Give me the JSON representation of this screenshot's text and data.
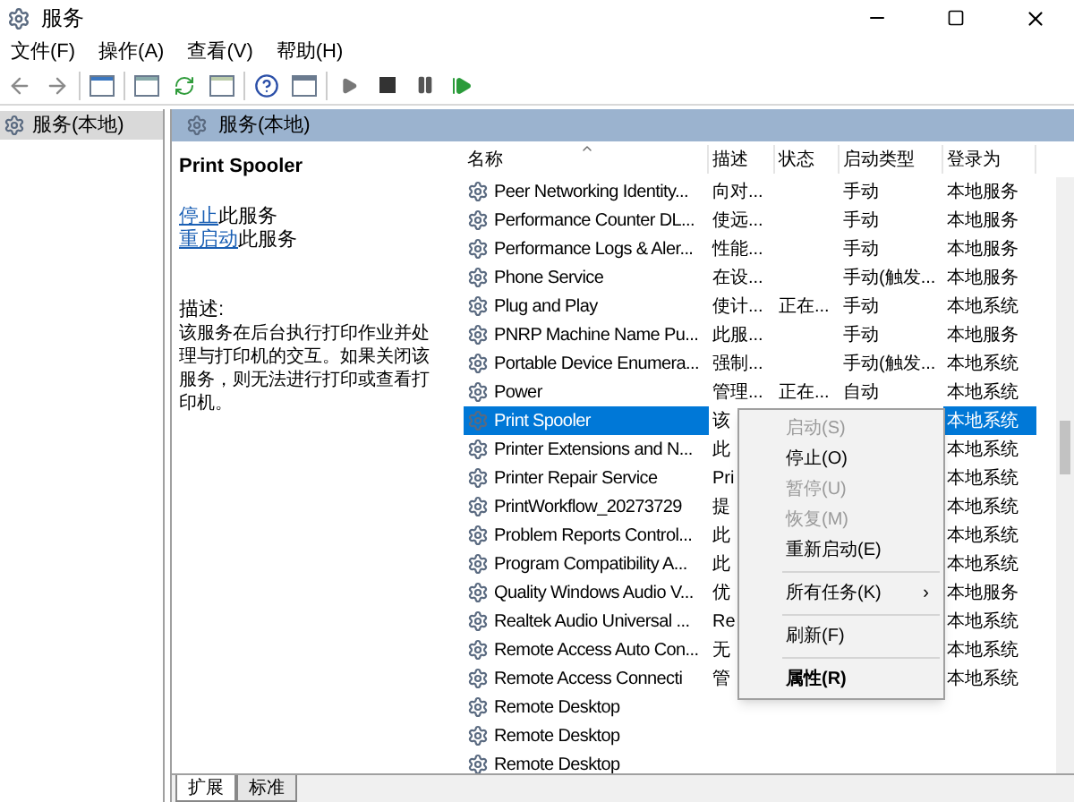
{
  "window": {
    "title": "服务"
  },
  "menu": [
    "文件(F)",
    "操作(A)",
    "查看(V)",
    "帮助(H)"
  ],
  "tree": {
    "items": [
      {
        "label": "服务(本地)",
        "selected": true
      }
    ]
  },
  "panel": {
    "title": "服务(本地)"
  },
  "detail": {
    "service_name": "Print Spooler",
    "actions": [
      {
        "link": "停止",
        "rest": "此服务"
      },
      {
        "link": "重启动",
        "rest": "此服务"
      }
    ],
    "description_label": "描述:",
    "description": "该服务在后台执行打印作业并处理与打印机的交互。如果关闭该服务，则无法进行打印或查看打印机。"
  },
  "table": {
    "columns": [
      "名称",
      "描述",
      "状态",
      "启动类型",
      "登录为"
    ],
    "rows": [
      {
        "name": "Peer Networking Identity...",
        "description": "向对...",
        "status": "",
        "startup": "手动",
        "logon": "本地服务",
        "selected": false
      },
      {
        "name": "Performance Counter DL...",
        "description": "使远...",
        "status": "",
        "startup": "手动",
        "logon": "本地服务",
        "selected": false
      },
      {
        "name": "Performance Logs & Aler...",
        "description": "性能...",
        "status": "",
        "startup": "手动",
        "logon": "本地服务",
        "selected": false
      },
      {
        "name": "Phone Service",
        "description": "在设...",
        "status": "",
        "startup": "手动(触发...",
        "logon": "本地服务",
        "selected": false
      },
      {
        "name": "Plug and Play",
        "description": "使计...",
        "status": "正在...",
        "startup": "手动",
        "logon": "本地系统",
        "selected": false
      },
      {
        "name": "PNRP Machine Name Pu...",
        "description": "此服...",
        "status": "",
        "startup": "手动",
        "logon": "本地服务",
        "selected": false
      },
      {
        "name": "Portable Device Enumera...",
        "description": "强制...",
        "status": "",
        "startup": "手动(触发...",
        "logon": "本地系统",
        "selected": false
      },
      {
        "name": "Power",
        "description": "管理...",
        "status": "正在...",
        "startup": "自动",
        "logon": "本地系统",
        "selected": false
      },
      {
        "name": "Print Spooler",
        "description": "该",
        "status": "",
        "startup": "",
        "logon": "本地系统",
        "selected": true
      },
      {
        "name": "Printer Extensions and N...",
        "description": "此",
        "status": "",
        "startup": "",
        "logon": "本地系统",
        "selected": false
      },
      {
        "name": "Printer Repair Service",
        "description": "Pri",
        "status": "",
        "startup": "",
        "logon": "本地系统",
        "selected": false
      },
      {
        "name": "PrintWorkflow_20273729",
        "description": "提",
        "status": "",
        "startup": "",
        "logon": "本地系统",
        "selected": false
      },
      {
        "name": "Problem Reports Control...",
        "description": "此",
        "status": "",
        "startup": "",
        "logon": "本地系统",
        "selected": false
      },
      {
        "name": "Program Compatibility A...",
        "description": "此",
        "status": "",
        "startup": "",
        "logon": "本地系统",
        "selected": false
      },
      {
        "name": "Quality Windows Audio V...",
        "description": "优",
        "status": "",
        "startup": "",
        "logon": "本地服务",
        "selected": false
      },
      {
        "name": "Realtek Audio Universal ...",
        "description": "Re",
        "status": "",
        "startup": "",
        "logon": "本地系统",
        "selected": false
      },
      {
        "name": "Remote Access Auto Con...",
        "description": "无",
        "status": "",
        "startup": "",
        "logon": "本地系统",
        "selected": false
      },
      {
        "name": "Remote Access Connecti",
        "description": "管",
        "status": "",
        "startup": "",
        "logon": "本地系统",
        "selected": false
      },
      {
        "name": "Remote Desktop",
        "description": "",
        "status": "",
        "startup": "",
        "logon": "",
        "selected": false
      },
      {
        "name": "Remote Desktop",
        "description": "",
        "status": "",
        "startup": "",
        "logon": "",
        "selected": false
      },
      {
        "name": "Remote Desktop",
        "description": "",
        "status": "",
        "startup": "",
        "logon": "",
        "selected": false
      }
    ]
  },
  "context_menu": [
    {
      "kind": "item",
      "label": "启动(S)",
      "disabled": true
    },
    {
      "kind": "item",
      "label": "停止(O)",
      "disabled": false
    },
    {
      "kind": "item",
      "label": "暂停(U)",
      "disabled": true
    },
    {
      "kind": "item",
      "label": "恢复(M)",
      "disabled": true
    },
    {
      "kind": "item",
      "label": "重新启动(E)",
      "disabled": false
    },
    {
      "kind": "separator"
    },
    {
      "kind": "submenu",
      "label": "所有任务(K)",
      "arrow": "›",
      "disabled": false
    },
    {
      "kind": "separator"
    },
    {
      "kind": "item",
      "label": "刷新(F)",
      "disabled": false
    },
    {
      "kind": "separator"
    },
    {
      "kind": "default",
      "label": "属性(R)",
      "disabled": false
    }
  ],
  "bottom_tabs": [
    {
      "label": "扩展",
      "selected": true
    },
    {
      "label": "标准",
      "selected": false
    }
  ]
}
